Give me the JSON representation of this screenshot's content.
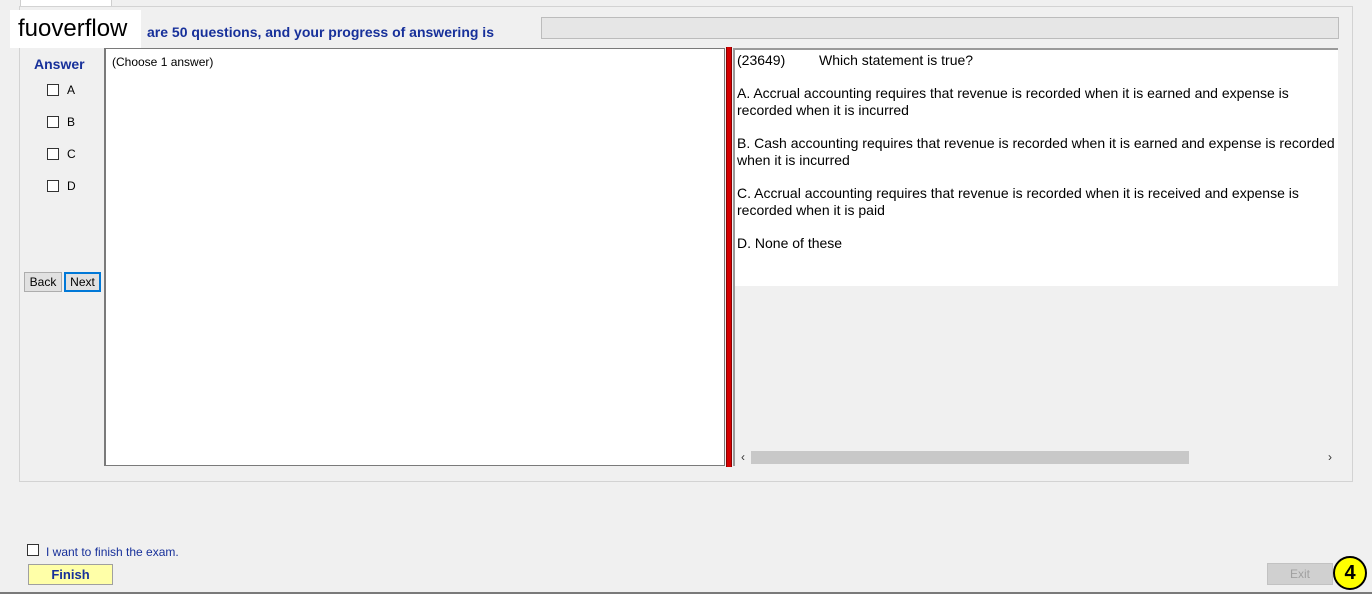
{
  "watermark": "fuoverflow",
  "progress": {
    "text": "are 50 questions, and your progress of answering is",
    "value": 0
  },
  "answer": {
    "heading": "Answer",
    "options": [
      "A",
      "B",
      "C",
      "D"
    ]
  },
  "nav": {
    "back_label": "Back",
    "next_label": "Next"
  },
  "notes": {
    "hint": "(Choose 1 answer)"
  },
  "question": {
    "id": "(23649)",
    "prompt": "Which statement is true?",
    "options": [
      "A.  Accrual accounting requires that revenue is recorded when it is earned and expense is recorded when it is incurred",
      "B.  Cash accounting requires that revenue is recorded when it is earned and expense is recorded when it is incurred",
      "C.  Accrual accounting requires that revenue is recorded when it is received and expense is recorded when it is paid",
      "D.  None of these"
    ]
  },
  "finish": {
    "checkbox_label": "I want to finish the exam.",
    "button_label": "Finish"
  },
  "exit_label": "Exit",
  "badge": "4",
  "colors": {
    "accent": "#17309a",
    "splitter": "#d40000",
    "finish_bg": "#ffffa8",
    "badge_bg": "#ffff00"
  }
}
